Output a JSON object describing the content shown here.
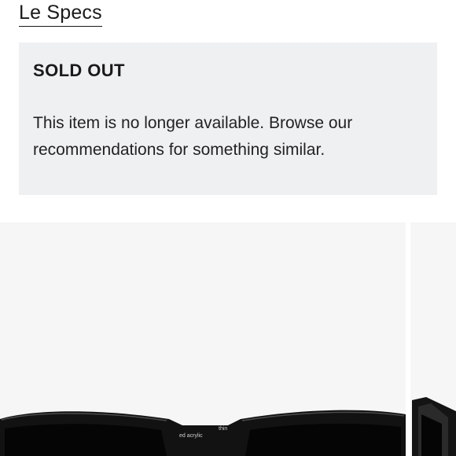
{
  "brand": {
    "name": "Le Specs"
  },
  "notice": {
    "heading": "SOLD OUT",
    "message": "This item is no longer available. Browse our recommendations for something similar."
  },
  "gallery": {
    "frame_text": [
      "thin",
      "ed acrylic"
    ]
  }
}
